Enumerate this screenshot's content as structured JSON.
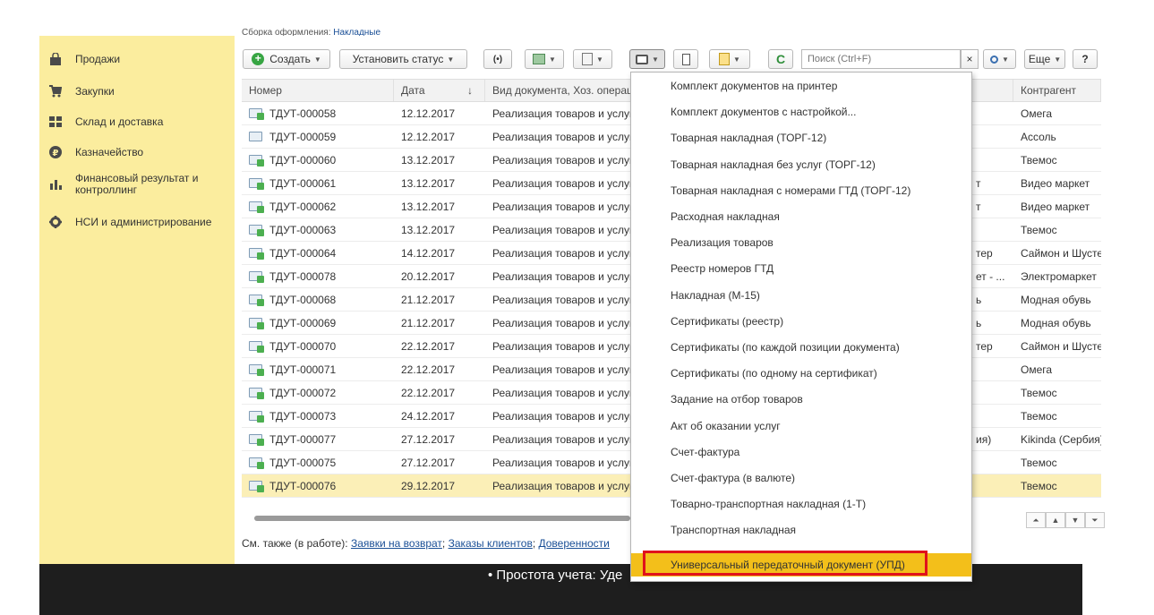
{
  "header_cutoff": {
    "label": "Сборка оформления:",
    "link": "Накладные"
  },
  "sidebar": {
    "items": [
      {
        "label": "Продажи",
        "icon": "bag-icon"
      },
      {
        "label": "Закупки",
        "icon": "cart-icon"
      },
      {
        "label": "Склад и доставка",
        "icon": "warehouse-icon"
      },
      {
        "label": "Казначейство",
        "icon": "ruble-icon"
      },
      {
        "label": "Финансовый результат и контроллинг",
        "icon": "chart-bars-icon"
      },
      {
        "label": "НСИ и администрирование",
        "icon": "gear-icon"
      }
    ]
  },
  "toolbar": {
    "create_label": "Создать",
    "set_status_label": "Установить статус",
    "search_placeholder": "Поиск (Ctrl+F)",
    "clear_label": "×",
    "more_label": "Еще",
    "help_label": "?"
  },
  "table": {
    "columns": [
      "Номер",
      "Дата",
      "Вид документа, Хоз. операция",
      "Контрагент"
    ],
    "sort_indicator": "↓",
    "rows": [
      {
        "number": "ТДУТ-000058",
        "date": "12.12.2017",
        "kind": "Реализация товаров и услуг",
        "mid": "",
        "contractor": "Омега",
        "posted": true
      },
      {
        "number": "ТДУТ-000059",
        "date": "12.12.2017",
        "kind": "Реализация товаров и услуг",
        "mid": "",
        "contractor": "Ассоль",
        "posted": false
      },
      {
        "number": "ТДУТ-000060",
        "date": "13.12.2017",
        "kind": "Реализация товаров и услуг",
        "mid": "",
        "contractor": "Твемос",
        "posted": true
      },
      {
        "number": "ТДУТ-000061",
        "date": "13.12.2017",
        "kind": "Реализация товаров и услуг",
        "mid": "т",
        "contractor": "Видео маркет",
        "posted": true
      },
      {
        "number": "ТДУТ-000062",
        "date": "13.12.2017",
        "kind": "Реализация товаров и услуг",
        "mid": "т",
        "contractor": "Видео маркет",
        "posted": true
      },
      {
        "number": "ТДУТ-000063",
        "date": "13.12.2017",
        "kind": "Реализация товаров и услуг",
        "mid": "",
        "contractor": "Твемос",
        "posted": true
      },
      {
        "number": "ТДУТ-000064",
        "date": "14.12.2017",
        "kind": "Реализация товаров и услуг",
        "mid": "тер",
        "contractor": "Саймон и Шустер",
        "posted": true
      },
      {
        "number": "ТДУТ-000078",
        "date": "20.12.2017",
        "kind": "Реализация товаров и услуг",
        "mid": "ет - ...",
        "contractor": "Электромаркет",
        "posted": true
      },
      {
        "number": "ТДУТ-000068",
        "date": "21.12.2017",
        "kind": "Реализация товаров и услуг",
        "mid": "ь",
        "contractor": "Модная обувь",
        "posted": true
      },
      {
        "number": "ТДУТ-000069",
        "date": "21.12.2017",
        "kind": "Реализация товаров и услуг",
        "mid": "ь",
        "contractor": "Модная обувь",
        "posted": true
      },
      {
        "number": "ТДУТ-000070",
        "date": "22.12.2017",
        "kind": "Реализация товаров и услуг",
        "mid": "тер",
        "contractor": "Саймон и Шустер",
        "posted": true
      },
      {
        "number": "ТДУТ-000071",
        "date": "22.12.2017",
        "kind": "Реализация товаров и услуг",
        "mid": "",
        "contractor": "Омега",
        "posted": true
      },
      {
        "number": "ТДУТ-000072",
        "date": "22.12.2017",
        "kind": "Реализация товаров и услуг",
        "mid": "",
        "contractor": "Твемос",
        "posted": true
      },
      {
        "number": "ТДУТ-000073",
        "date": "24.12.2017",
        "kind": "Реализация товаров и услуг",
        "mid": "",
        "contractor": "Твемос",
        "posted": true
      },
      {
        "number": "ТДУТ-000077",
        "date": "27.12.2017",
        "kind": "Реализация товаров и услуг",
        "mid": "ия)",
        "contractor": "Kikinda (Сербия)",
        "posted": true
      },
      {
        "number": "ТДУТ-000075",
        "date": "27.12.2017",
        "kind": "Реализация товаров и услуг",
        "mid": "",
        "contractor": "Твемос",
        "posted": true
      },
      {
        "number": "ТДУТ-000076",
        "date": "29.12.2017",
        "kind": "Реализация товаров и услуг",
        "mid": "",
        "contractor": "Твемос",
        "posted": true
      }
    ]
  },
  "see_also": {
    "label": "См. также (в работе):",
    "links": [
      "Заявки на возврат",
      "Заказы клиентов",
      "Доверенности"
    ]
  },
  "print_menu": {
    "items": [
      "Комплект документов на принтер",
      "Комплект документов с настройкой...",
      "Товарная накладная (ТОРГ-12)",
      "Товарная накладная без услуг (ТОРГ-12)",
      "Товарная накладная с номерами ГТД (ТОРГ-12)",
      "Расходная накладная",
      "Реализация товаров",
      "Реестр номеров ГТД",
      "Накладная (М-15)",
      "Сертификаты (реестр)",
      "Сертификаты (по каждой позиции документа)",
      "Сертификаты (по одному на сертификат)",
      "Задание на отбор товаров",
      "Акт об оказании услуг",
      "Счет-фактура",
      "Счет-фактура (в валюте)",
      "Товарно-транспортная накладная (1-Т)",
      "Транспортная накладная",
      "Универсальный передаточный документ (УПД)"
    ],
    "highlighted_index": 18,
    "highlight_color": "#f3bf1a",
    "outline_color": "#e0121c"
  },
  "bottom_banner": {
    "text": "Простота учета: Уде"
  },
  "colors": {
    "sidebar_bg": "#fbed9e",
    "selected_row": "#fbefb7",
    "link": "#1a4f96"
  }
}
